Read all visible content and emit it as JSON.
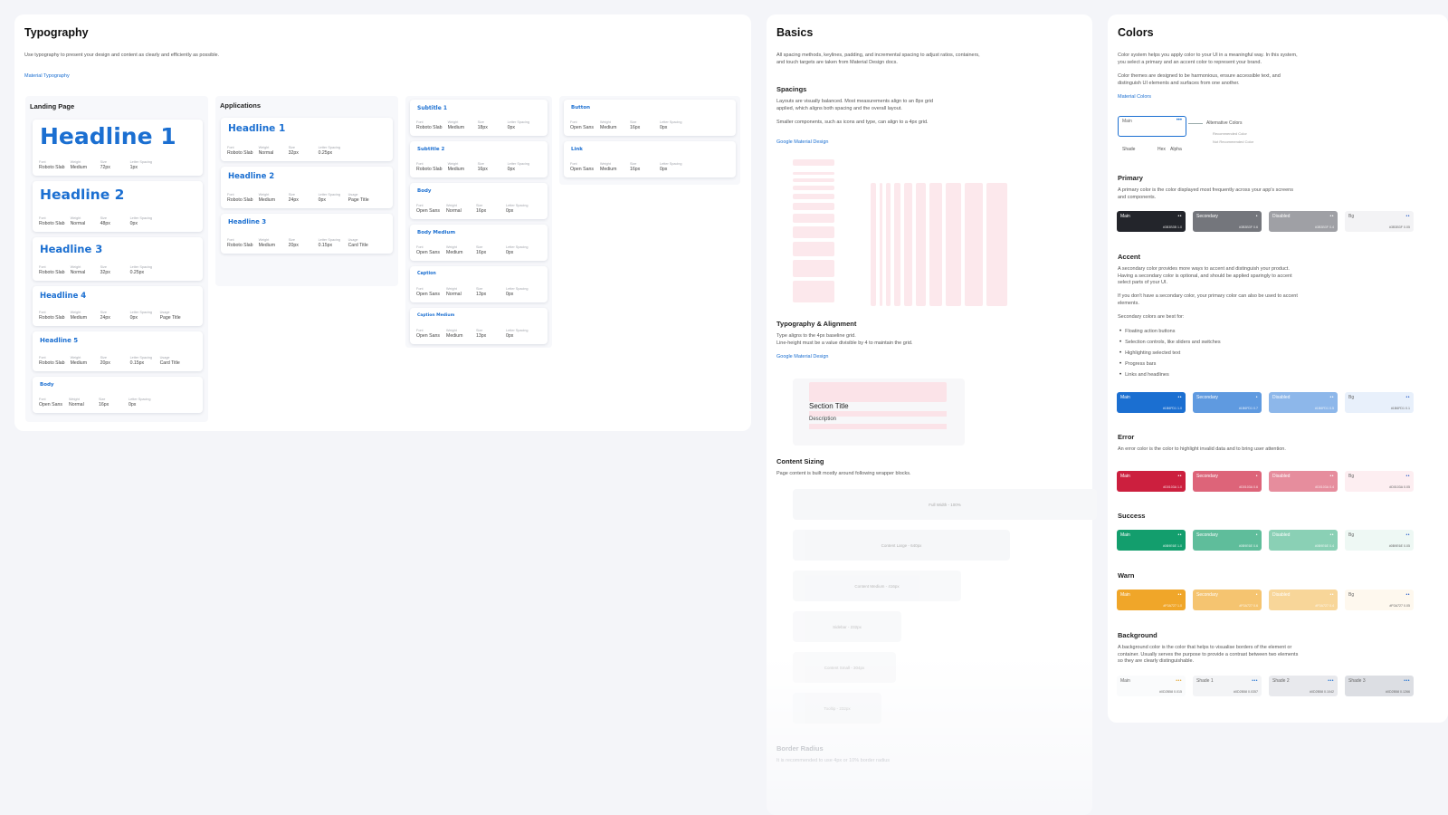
{
  "typography": {
    "title": "Typography",
    "desc": "Use typography to present your design and content as clearly and efficiently as possible.",
    "link": "Material Typography",
    "spec_keys": {
      "font": "Font",
      "weight": "Weight",
      "size": "Size",
      "ls": "Letter Spacing",
      "usage": "Usage"
    },
    "landing": {
      "heading": "Landing Page",
      "cards": [
        {
          "title": "Headline 1",
          "font": "Roboto Slab",
          "weight": "Medium",
          "size": "72px",
          "ls": "1px",
          "usage": ""
        },
        {
          "title": "Headline 2",
          "font": "Roboto Slab",
          "weight": "Normal",
          "size": "48px",
          "ls": "0px",
          "usage": ""
        },
        {
          "title": "Headline 3",
          "font": "Roboto Slab",
          "weight": "Normal",
          "size": "32px",
          "ls": "0.25px",
          "usage": ""
        },
        {
          "title": "Headline 4",
          "font": "Roboto Slab",
          "weight": "Medium",
          "size": "24px",
          "ls": "0px",
          "usage": "Page Title"
        },
        {
          "title": "Headline 5",
          "font": "Roboto Slab",
          "weight": "Medium",
          "size": "20px",
          "ls": "0.15px",
          "usage": "Card Title"
        },
        {
          "title": "Body",
          "font": "Open Sans",
          "weight": "Normal",
          "size": "16px",
          "ls": "0px",
          "usage": ""
        }
      ]
    },
    "applications": {
      "heading": "Applications",
      "cards": [
        {
          "title": "Headline 1",
          "font": "Roboto Slab",
          "weight": "Normal",
          "size": "32px",
          "ls": "0.25px",
          "usage": ""
        },
        {
          "title": "Headline 2",
          "font": "Roboto Slab",
          "weight": "Medium",
          "size": "24px",
          "ls": "0px",
          "usage": "Page Title"
        },
        {
          "title": "Headline 3",
          "font": "Roboto Slab",
          "weight": "Medium",
          "size": "20px",
          "ls": "0.15px",
          "usage": "Card Title"
        }
      ]
    },
    "text_styles": {
      "cards": [
        {
          "title": "Subtitle 1",
          "font": "Roboto Slab",
          "weight": "Medium",
          "size": "18px",
          "ls": "0px"
        },
        {
          "title": "Subtitle 2",
          "font": "Roboto Slab",
          "weight": "Medium",
          "size": "16px",
          "ls": "0px"
        },
        {
          "title": "Body",
          "font": "Open Sans",
          "weight": "Normal",
          "size": "16px",
          "ls": "0px"
        },
        {
          "title": "Body Medium",
          "font": "Open Sans",
          "weight": "Medium",
          "size": "16px",
          "ls": "0px"
        },
        {
          "title": "Caption",
          "font": "Open Sans",
          "weight": "Normal",
          "size": "13px",
          "ls": "0px"
        },
        {
          "title": "Caption Medium",
          "font": "Open Sans",
          "weight": "Medium",
          "size": "13px",
          "ls": "0px"
        }
      ]
    },
    "controls": {
      "cards": [
        {
          "title": "Button",
          "font": "Open Sans",
          "weight": "Medium",
          "size": "16px",
          "ls": "0px"
        },
        {
          "title": "Link",
          "font": "Open Sans",
          "weight": "Medium",
          "size": "16px",
          "ls": "0px"
        }
      ]
    }
  },
  "basics": {
    "title": "Basics",
    "desc": "All spacing methods, keylines, padding, and incremental spacing to adjust ratios, containers, and touch targets are taken from Material Design docs.",
    "spacings": {
      "heading": "Spacings",
      "desc1": "Layouts are visually balanced. Most measurements align to an 8px grid applied, which aligns both spacing and the overall layout.",
      "desc2": "Smaller components, such as icons and type, can align to a 4px grid.",
      "link": "Google Material Design"
    },
    "typo_align": {
      "heading": "Typography & Alignment",
      "desc": "Type aligns to the 4px baseline grid.\nLine-height must be a value divisible by 4 to maintain the grid.",
      "link": "Google Material Design",
      "sample_title": "Section Title",
      "sample_desc": "Description"
    },
    "content_sizing": {
      "heading": "Content Sizing",
      "desc": "Page content is built mostly around following wrapper blocks.",
      "blocks": [
        "Full Width - 100%",
        "Content Large - 640px",
        "Content Medium - 416px",
        "Sidebar - 232px",
        "Content Small - 304px",
        "Tooltip - 232px"
      ]
    },
    "border_radius": {
      "heading": "Border Radius",
      "desc": "It is recommended to use 4px or 10% border radius"
    }
  },
  "colors": {
    "title": "Colors",
    "desc1": "Color system helps you apply color to your UI in a meaningful way. In this system, you select a primary and an accent color to represent your brand.",
    "desc2": "Color themes are designed to be harmonious, ensure accessible text, and distinguish UI elements and surfaces from one another.",
    "link": "Material Colors",
    "legend": {
      "main": "Main",
      "alt": "Alternative Colors",
      "rec": "Recommended Color",
      "notrec": "Not Recommended Color",
      "shade": "Shade",
      "hex": "Hex",
      "alpha": "Alpha"
    },
    "primary": {
      "heading": "Primary",
      "desc": "A primary color is the color displayed most frequently across your app's screens and components.",
      "swatches": [
        {
          "name": "Main",
          "hex": "#3B3B3B 1.0",
          "color": "#23252b"
        },
        {
          "name": "Secondary",
          "hex": "#3B3B3F 0.6",
          "color": "#74767c"
        },
        {
          "name": "Disabled",
          "hex": "#3B3B3F 0.4",
          "color": "#9fa0a5"
        },
        {
          "name": "Bg",
          "hex": "#3B3B3F 0.05",
          "color": "#f3f3f5"
        }
      ]
    },
    "accent": {
      "heading": "Accent",
      "desc1": "A secondary color provides more ways to accent and distinguish your product. Having a secondary color is optional, and should be applied sparingly to accent select parts of your UI.",
      "desc2": "If you don't have a secondary color, your primary color can also be used to accent elements.",
      "desc3": "Secondary colors are best for:",
      "bullets": [
        "Floating action buttons",
        "Selection controls, like sliders and switches",
        "Highlighting selected text",
        "Progress bars",
        "Links and headlines"
      ],
      "swatches": [
        {
          "name": "Main",
          "hex": "#1B6FD1 1.0",
          "color": "#1b6fd1"
        },
        {
          "name": "Secondary",
          "hex": "#1B6FD1 0.7",
          "color": "#5f9ae0"
        },
        {
          "name": "Disabled",
          "hex": "#1B6FD1 0.5",
          "color": "#8db7ea"
        },
        {
          "name": "Bg",
          "hex": "#1B6FD1 0.1",
          "color": "#e8f0fb"
        }
      ]
    },
    "error": {
      "heading": "Error",
      "desc": "An error color is the color to highlight invalid data and to bring user attention.",
      "swatches": [
        {
          "name": "Main",
          "hex": "#D0103A 1.0",
          "color": "#cc1f3e"
        },
        {
          "name": "Secondary",
          "hex": "#D0103A 0.6",
          "color": "#dd6479"
        },
        {
          "name": "Disabled",
          "hex": "#D0103A 0.4",
          "color": "#e68d9d"
        },
        {
          "name": "Bg",
          "hex": "#D0103A 0.05",
          "color": "#fdeef1"
        }
      ]
    },
    "success": {
      "heading": "Success",
      "desc": "",
      "swatches": [
        {
          "name": "Main",
          "hex": "#0B9E6E 1.0",
          "color": "#139e6d"
        },
        {
          "name": "Secondary",
          "hex": "#0B9E6E 0.6",
          "color": "#5fbd9b"
        },
        {
          "name": "Disabled",
          "hex": "#0B9E6E 0.4",
          "color": "#8ad0b5"
        },
        {
          "name": "Bg",
          "hex": "#0B9E6E 0.05",
          "color": "#eef8f4"
        }
      ]
    },
    "warn": {
      "heading": "Warn",
      "desc": "",
      "swatches": [
        {
          "name": "Main",
          "hex": "#F0A727 1.0",
          "color": "#f0a629"
        },
        {
          "name": "Secondary",
          "hex": "#F0A727 0.6",
          "color": "#f5c470"
        },
        {
          "name": "Disabled",
          "hex": "#F0A727 0.4",
          "color": "#f8d699"
        },
        {
          "name": "Bg",
          "hex": "#F0A727 0.05",
          "color": "#fef8ee"
        }
      ]
    },
    "background": {
      "heading": "Background",
      "desc": "A background color is the color that helps to visualise borders of the element or container. Usually serves the purpose to provide a contrast between two elements so they are clearly distinguishable.",
      "swatches": [
        {
          "name": "Main",
          "hex": "#0D2B58 0.015",
          "color": "#fafbfc"
        },
        {
          "name": "Shade 1",
          "hex": "#0D2B58 0.0357",
          "color": "#f3f4f6"
        },
        {
          "name": "Shade 2",
          "hex": "#0D2B58 0.1042",
          "color": "#e8e9ed"
        },
        {
          "name": "Shade 3",
          "hex": "#0D2B58 0.1266",
          "color": "#dcdee3"
        }
      ]
    }
  }
}
